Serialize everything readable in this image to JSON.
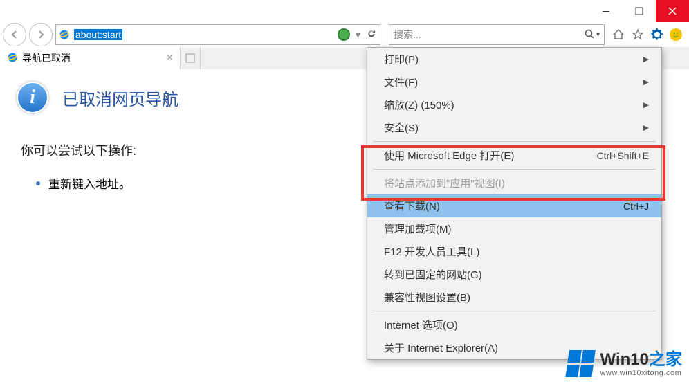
{
  "address_bar": {
    "url": "about:start"
  },
  "search": {
    "placeholder": "搜索..."
  },
  "tab": {
    "title": "导航已取消"
  },
  "page": {
    "heading": "已取消网页导航",
    "subheading": "你可以尝试以下操作:",
    "bullet1": "重新键入地址。"
  },
  "menu": {
    "print": "打印(P)",
    "file": "文件(F)",
    "zoom": "缩放(Z) (150%)",
    "safety": "安全(S)",
    "edge": "使用 Microsoft Edge 打开(E)",
    "edge_sc": "Ctrl+Shift+E",
    "addsite": "将站点添加到\"应用\"视图(I)",
    "downloads": "查看下载(N)",
    "downloads_sc": "Ctrl+J",
    "addons": "管理加载项(M)",
    "f12": "F12 开发人员工具(L)",
    "pinned": "转到已固定的网站(G)",
    "compat": "兼容性视图设置(B)",
    "options": "Internet 选项(O)",
    "about": "关于 Internet Explorer(A)"
  },
  "watermark": {
    "brand_a": "Win10",
    "brand_b": "之家",
    "url": "www.win10xitong.com"
  }
}
